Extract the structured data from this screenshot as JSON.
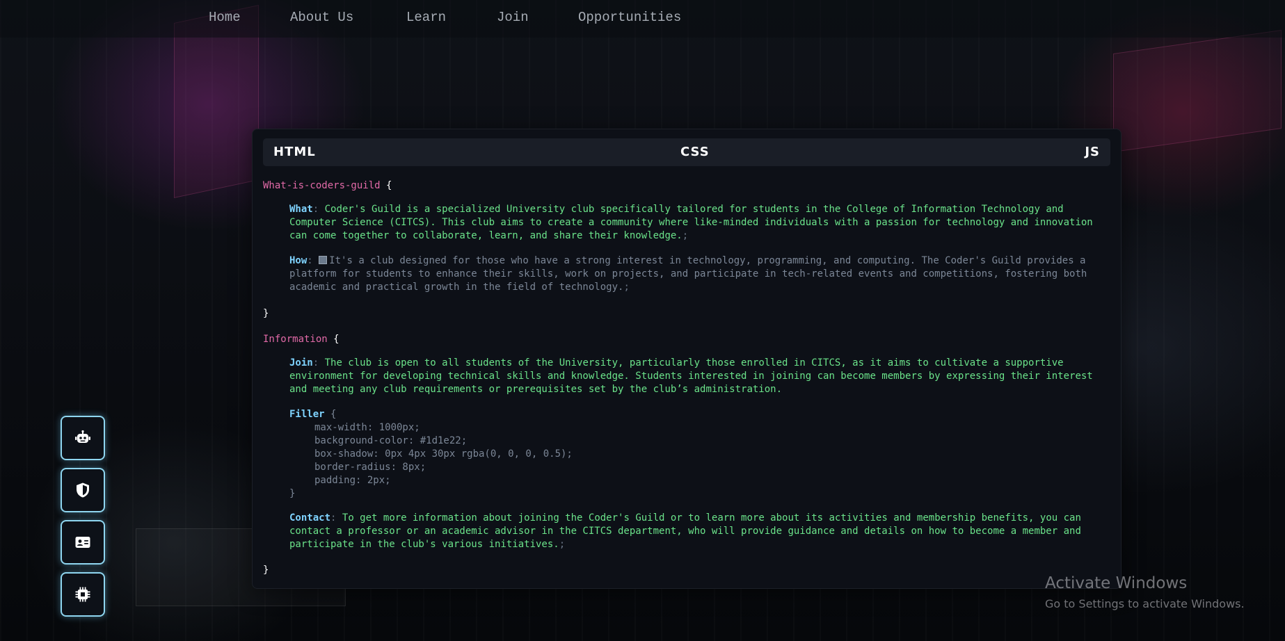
{
  "nav": {
    "links": [
      "Home",
      "About Us",
      "Learn",
      "Join",
      "Opportunities"
    ]
  },
  "tabs": {
    "html": "HTML",
    "css": "CSS",
    "js": "JS"
  },
  "code": {
    "block1": {
      "selector": "What-is-coders-guild",
      "open": "{",
      "close": "}",
      "what_label": "What",
      "what_text": "Coder's Guild is a specialized University club specifically tailored for students in the College of Information Technology and Computer Science (CITCS). This club aims to create a community where like-minded individuals with a passion for technology and innovation can come together to collaborate, learn, and share their knowledge.",
      "how_label": "How",
      "how_text": "It's a club designed for those who have a strong interest in technology, programming, and computing. The Coder's Guild provides a platform for students to enhance their skills, work on projects, and participate in tech-related events and competitions, fostering both academic and practical growth in the field of technology."
    },
    "block2": {
      "selector": "Information",
      "open": "{",
      "close": "}",
      "join_label": "Join",
      "join_text": "The club is open to all students of the University, particularly those enrolled in CITCS, as it aims to cultivate a supportive environment for developing technical skills and knowledge. Students interested in joining can become members by expressing their interest and meeting any club requirements or prerequisites set by the club’s administration.",
      "filler_label": "Filler",
      "filler_open": "{",
      "filler_lines": [
        "max-width: 1000px;",
        "background-color: #1d1e22;",
        "box-shadow: 0px 4px 30px rgba(0, 0, 0, 0.5);",
        "border-radius: 8px;",
        "padding: 2px;"
      ],
      "filler_close": "}",
      "contact_label": "Contact",
      "contact_text": "To get more information about joining the Coder's Guild or to learn more about its activities and membership benefits, you can contact a professor or an academic advisor in the CITCS department, who will provide guidance and details on how to become a member and participate in the club's various initiatives."
    },
    "colon": ":",
    "semicolon": ";"
  },
  "sidebar": {
    "icons": [
      "robot-icon",
      "shield-icon",
      "id-card-icon",
      "chip-icon"
    ]
  },
  "watermark": {
    "title": "Activate Windows",
    "subtitle": "Go to Settings to activate Windows."
  },
  "colors": {
    "accent_cyan": "#8fd6f0",
    "selector_pink": "#e26aa8",
    "text_green": "#6be38a",
    "prop_blue": "#7fd3ff",
    "panel_bg": "#0d1017",
    "tabbar_bg": "#1a1e27"
  }
}
